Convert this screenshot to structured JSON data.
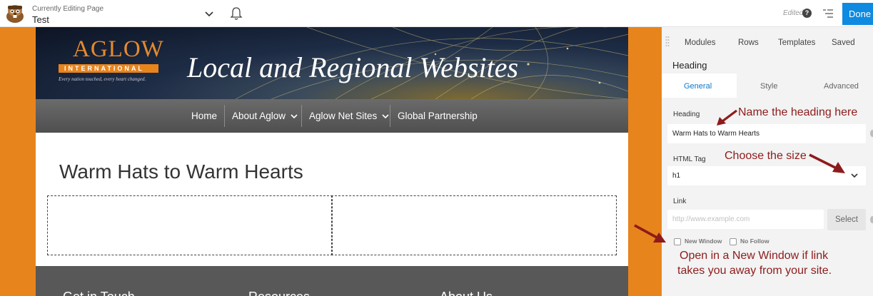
{
  "topbar": {
    "subtitle": "Currently Editing Page",
    "page_name": "Test",
    "status": "Edited",
    "help_glyph": "?",
    "done_label": "Done",
    "accent_color": "#0e8ae0"
  },
  "site": {
    "logo_word": "AGLOW",
    "logo_sub": "INTERNATIONAL",
    "logo_tagline": "Every nation touched, every heart changed.",
    "banner_title": "Local and Regional Websites",
    "nav": [
      "Home",
      "About Aglow",
      "Aglow Net Sites",
      "Global Partnership"
    ],
    "heading": "Warm Hats to Warm Hearts",
    "footer_headings": [
      "Get in Touch",
      "Resources",
      "About Us"
    ],
    "side_color": "#e8841c"
  },
  "panel": {
    "tabs": [
      "Modules",
      "Rows",
      "Templates",
      "Saved"
    ],
    "title": "Heading",
    "subtabs": [
      "General",
      "Style",
      "Advanced"
    ],
    "heading_label": "Heading",
    "heading_value": "Warm Hats to Warm Hearts",
    "tag_label": "HTML Tag",
    "tag_value": "h1",
    "link_label": "Link",
    "link_placeholder": "http://www.example.com",
    "select_label": "Select",
    "new_window_label": "New Window",
    "no_follow_label": "No Follow"
  },
  "annotations": {
    "name_heading": "Name the heading here",
    "choose_size": "Choose the size",
    "new_window_line1": "Open in a New Window if link",
    "new_window_line2": "takes you away from your site.",
    "color": "#8e1b1b"
  }
}
